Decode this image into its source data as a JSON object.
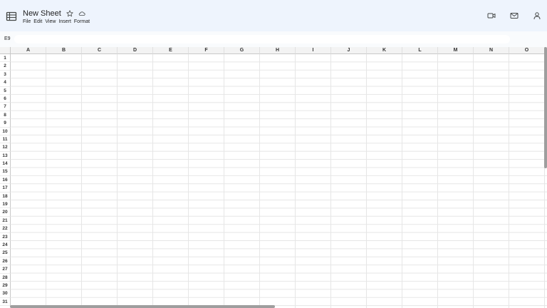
{
  "header": {
    "title": "New Sheet",
    "icons": {
      "app": "spreadsheet-icon",
      "star": "star-icon",
      "cloud": "cloud-icon",
      "video": "video-camera-icon",
      "mail": "mail-icon",
      "account": "account-icon"
    },
    "menu": [
      "File",
      "Edit",
      "View",
      "Insert",
      "Format"
    ]
  },
  "formula_bar": {
    "cell_ref": "E9",
    "value": ""
  },
  "grid": {
    "columns": [
      "A",
      "B",
      "C",
      "D",
      "E",
      "F",
      "G",
      "H",
      "I",
      "J",
      "K",
      "L",
      "M",
      "N",
      "O"
    ],
    "rows": [
      "1",
      "2",
      "3",
      "4",
      "5",
      "6",
      "7",
      "8",
      "9",
      "10",
      "11",
      "12",
      "13",
      "14",
      "15",
      "16",
      "17",
      "18",
      "19",
      "20",
      "21",
      "22",
      "23",
      "24",
      "25",
      "26",
      "27",
      "28",
      "29",
      "30",
      "31"
    ]
  },
  "colors": {
    "header_bg": "#eef4fd",
    "formula_bg": "#f9fbfd",
    "header_cell_bg": "#f3f3f3",
    "scrollbar": "#9e9e9e"
  }
}
